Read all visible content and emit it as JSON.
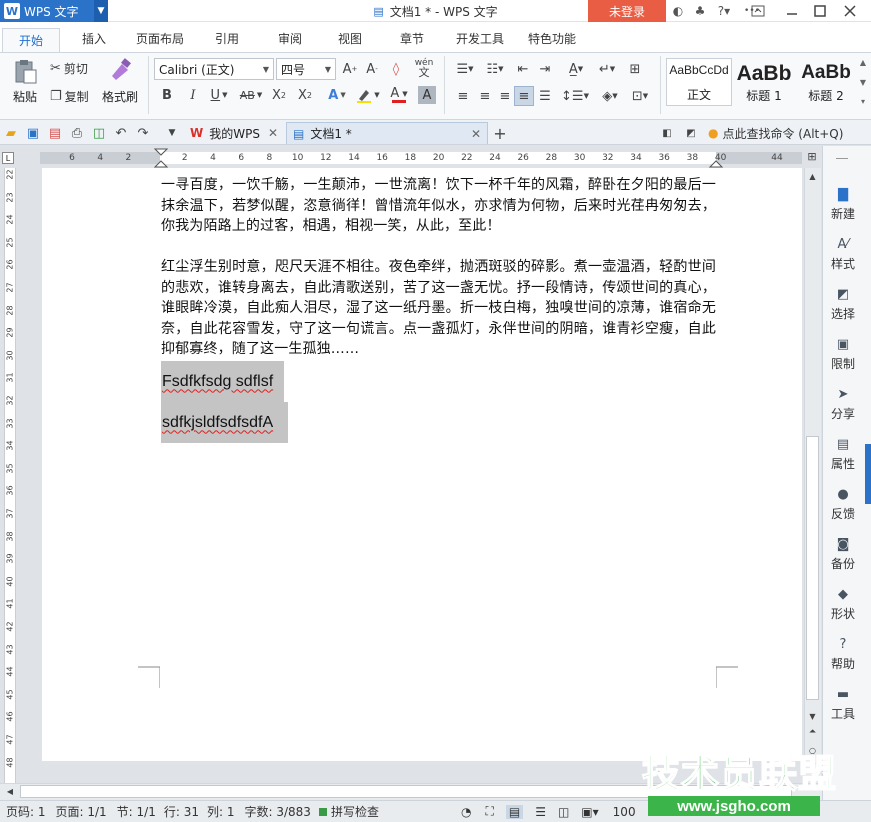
{
  "titlebar": {
    "app_name": "WPS 文字",
    "window_title": "文档1 * - WPS 文字",
    "login": "未登录"
  },
  "ribbon_tabs": [
    "开始",
    "插入",
    "页面布局",
    "引用",
    "审阅",
    "视图",
    "章节",
    "开发工具",
    "特色功能"
  ],
  "ribbon": {
    "paste": "粘贴",
    "cut": "剪切",
    "copy": "复制",
    "format_painter": "格式刷",
    "font_name": "Calibri (正文)",
    "font_size": "四号",
    "styles": [
      {
        "preview": "AaBbCcDd",
        "name": "正文"
      },
      {
        "preview": "AaBb",
        "name": "标题 1"
      },
      {
        "preview": "AaBb",
        "name": "标题 2"
      }
    ]
  },
  "doc_tabs": {
    "home": "我的WPS",
    "document": "文档1 *",
    "search": "点此查找命令 (Alt+Q)"
  },
  "ruler": {
    "h_labels": [
      "6",
      "4",
      "2",
      "",
      "2",
      "4",
      "6",
      "8",
      "10",
      "12",
      "14",
      "16",
      "18",
      "20",
      "22",
      "24",
      "26",
      "28",
      "30",
      "32",
      "34",
      "36",
      "38",
      "40",
      "",
      "44"
    ],
    "v_labels": [
      "22",
      "23",
      "24",
      "25",
      "26",
      "27",
      "28",
      "29",
      "30",
      "31",
      "32",
      "33",
      "34",
      "35",
      "36",
      "37",
      "38",
      "39",
      "40",
      "41",
      "42",
      "43",
      "44",
      "45",
      "46",
      "47",
      "48"
    ]
  },
  "document": {
    "para1": "一寻百度，一饮千觞，一生颠沛，一世流离！饮下一杯千年的风霜，醉卧在夕阳的最后一抹余温下，若梦似醒，恣意徜徉！曾惜流年似水，亦求情为何物，后来时光荏冉匆匆去，你我为陌路上的过客，相遇，相视一笑，从此，至此！",
    "para2": "红尘浮生别时意，咫尺天涯不相往。夜色牵绊，抛洒斑驳的碎影。煮一壶温酒，轻酌世间的悲欢，谁转身离去，自此清歌送别，苦了这一盏无忧。抒一段情诗，传颂世间的真心，谁眼眸冷漠，自此痴人泪尽，湿了这一纸丹墨。折一枝白梅，独嗅世间的凉薄，谁宿命无奈，自此花容雪发，守了这一句谎言。点一盏孤灯，永伴世间的阴暗，谁青衫空瘦，自此抑郁寡终，随了这一生孤独……",
    "line3": "Fsdfkfsdg sdflsf",
    "line4": "sdfkjsldfsdfsdfA"
  },
  "side_panel": [
    "新建",
    "样式",
    "选择",
    "限制",
    "分享",
    "属性",
    "反馈",
    "备份",
    "形状",
    "帮助",
    "工具"
  ],
  "status": {
    "page_num": "页码: 1",
    "pages": "页面: 1/1",
    "section": "节: 1/1",
    "row": "行: 31",
    "col": "列: 1",
    "words": "字数: 3/883",
    "spell": "拼写检查",
    "zoom": "100"
  },
  "watermark": {
    "brand": "技术员联盟",
    "url": "www.jsgho.com"
  },
  "colors": {
    "accent": "#2b73c9",
    "login": "#e85d43",
    "watermark_green": "#3bb54a"
  }
}
